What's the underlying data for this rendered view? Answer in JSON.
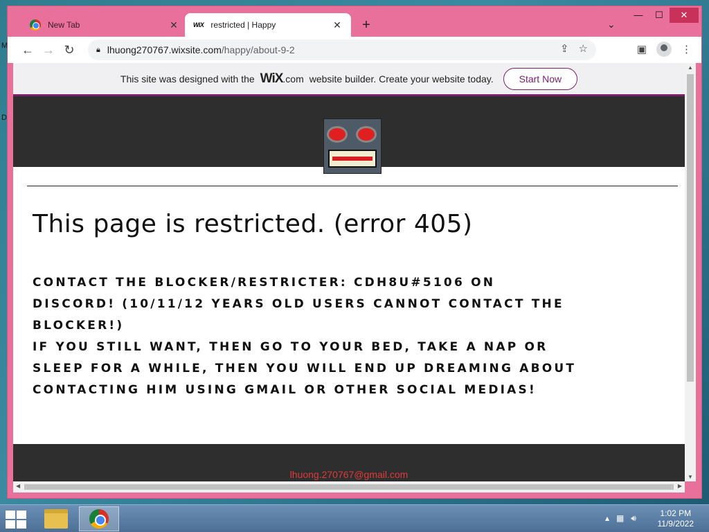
{
  "desktop": {
    "left_letters": [
      "M",
      "D"
    ]
  },
  "browser": {
    "tabs": [
      {
        "title": "New Tab",
        "icon": "chrome-icon",
        "active": false
      },
      {
        "title": "restricted | Happy",
        "icon": "wix-icon",
        "active": true,
        "favicon_text": "WiX"
      }
    ],
    "new_tab_label": "+",
    "tab_list_label": "⌄",
    "window_controls": {
      "minimize": "—",
      "maximize": "☐",
      "close": "✕"
    },
    "address": {
      "host": "lhuong270767.wixsite.com",
      "path": "/happy/about-9-2"
    }
  },
  "wix_banner": {
    "text_before": "This site was designed with the",
    "logo": "WiX",
    "logo_suffix": ".com",
    "text_after": "website builder. Create your website today.",
    "button": "Start Now"
  },
  "page": {
    "heading": "This page is restricted. (error 405)",
    "body_line1": "Contact the blocker/restricter: CDH8U#5106 on Discord! (10/11/12 years old users cannot contact the blocker!)",
    "body_line2": "If you still want, then go to your bed, take a nap or sleep for a while, then you will end up dreaming about contacting him using Gmail or other social medias!",
    "footer_email": "lhuong.270767@gmail.com"
  },
  "taskbar": {
    "time": "1:02 PM",
    "date": "11/9/2022",
    "tray_icons": [
      "chevron-up-icon",
      "network-icon",
      "volume-icon"
    ]
  },
  "colors": {
    "window_frame": "#e8709a",
    "wix_accent": "#7a1f6a",
    "footer_email": "#e03a3a"
  }
}
